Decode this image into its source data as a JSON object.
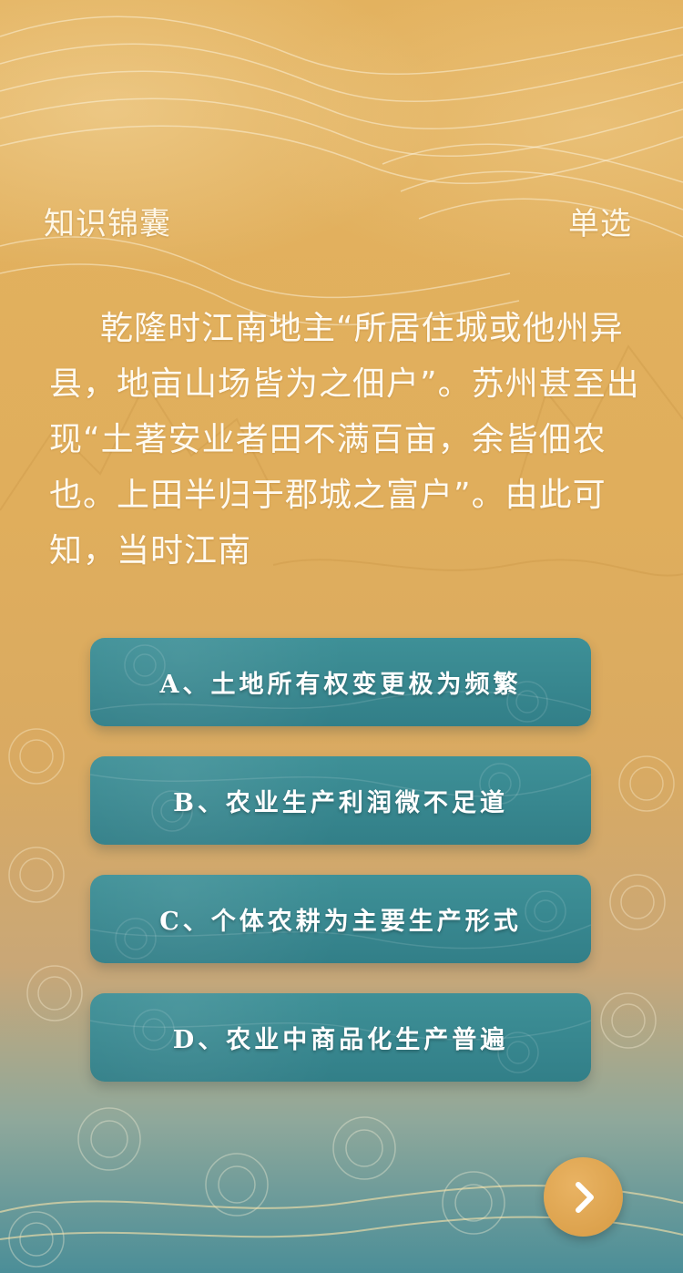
{
  "header": {
    "left_title": "知识锦囊",
    "right_label": "单选"
  },
  "question": {
    "text": "乾隆时江南地主“所居住城或他州异县，地亩山场皆为之佃户”。苏州甚至出现“土著安业者田不满百亩，余皆佃农也。上田半归于郡城之富户”。由此可知，当时江南"
  },
  "options": [
    {
      "label": "A、土地所有权变更极为频繁"
    },
    {
      "label": "B、农业生产利润微不足道"
    },
    {
      "label": "C、个体农耕为主要生产形式"
    },
    {
      "label": "D、农业中商品化生产普遍"
    }
  ],
  "next_button": {
    "icon": "chevron-right-icon"
  },
  "colors": {
    "background_top": "#e3b25f",
    "background_bottom": "#4b8e98",
    "option_teal": "#3a8a92",
    "next_button_gold": "#dca34d",
    "text_light": "#fffaf0"
  }
}
